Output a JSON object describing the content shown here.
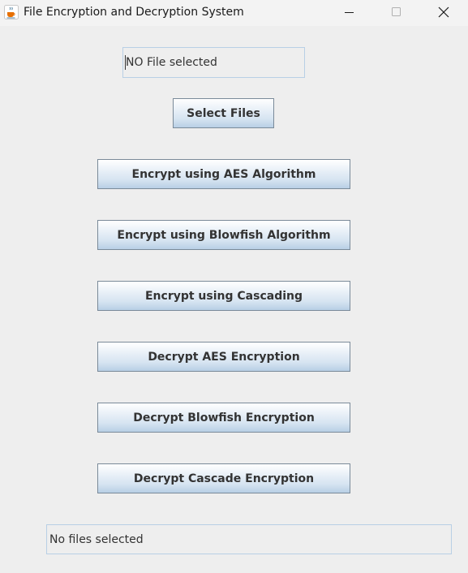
{
  "window": {
    "title": "File Encryption and Decryption System",
    "icon": "java-coffee-cup-icon"
  },
  "controls": {
    "minimize_icon": "minimize-icon",
    "maximize_icon": "maximize-icon",
    "close_icon": "close-icon"
  },
  "file_field": {
    "value": "NO File selected"
  },
  "buttons": {
    "select_files": "Select Files",
    "encrypt_aes": "Encrypt using AES Algorithm",
    "encrypt_blowfish": "Encrypt using Blowfish Algorithm",
    "encrypt_cascading": "Encrypt using Cascading",
    "decrypt_aes": "Decrypt AES Encryption",
    "decrypt_blowfish": "Decrypt Blowfish Encryption",
    "decrypt_cascade": "Decrypt Cascade Encryption"
  },
  "status": {
    "text": "No files selected"
  },
  "colors": {
    "background": "#eeeeee",
    "button_gradient_bottom": "#b8cfe5",
    "field_border": "#b8cfe5",
    "text": "#333333"
  }
}
